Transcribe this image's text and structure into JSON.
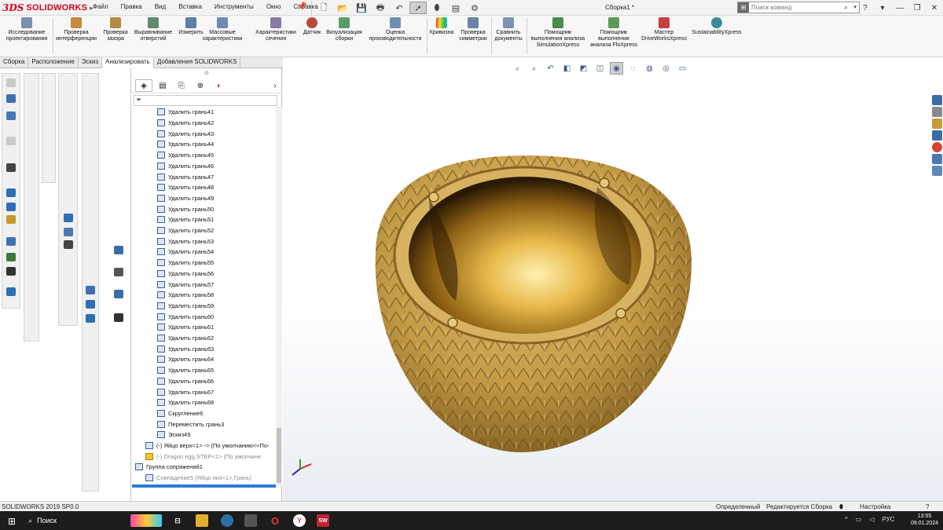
{
  "titlebar": {
    "logo_prefix": "3DS",
    "logo_text": "SOLIDWORKS",
    "menu": [
      "Файл",
      "Правка",
      "Вид",
      "Вставка",
      "Инструменты",
      "Окно",
      "Справка"
    ],
    "document_title": "Сборка1 *",
    "search_placeholder": "Поиск команд"
  },
  "commands": [
    {
      "label": "Исследование\nпроектирования"
    },
    {
      "label": "Проверка\nинтерференции"
    },
    {
      "label": "Проверка\nзазора"
    },
    {
      "label": "Выравнивание\nотверстий"
    },
    {
      "label": "Измерить"
    },
    {
      "label": "Массовые\nхарактеристики"
    },
    {
      "label": "Характеристики\nсечения"
    },
    {
      "label": "Датчик"
    },
    {
      "label": "Визуализация\nсборки"
    },
    {
      "label": "Оценка\nпроизводительности"
    },
    {
      "label": "Кривизна"
    },
    {
      "label": "Проверка\nсимметрии"
    },
    {
      "label": "Сравнить\nдокументы"
    },
    {
      "label": "Помощник\nвыполнения анализа\nSimulationXpress"
    },
    {
      "label": "Помощник\nвыполнения\nанализа FloXpress"
    },
    {
      "label": "Мастер\nDriveWorksXpress"
    },
    {
      "label": "SustainabilityXpress"
    }
  ],
  "tabs": [
    "Сборка",
    "Расположение",
    "Эскиз",
    "Анализировать",
    "Добавления SOLIDWORKS"
  ],
  "active_tab": "Анализировать",
  "tree": {
    "items": [
      "Удалить грань41",
      "Удалить грань42",
      "Удалить грань43",
      "Удалить грань44",
      "Удалить грань45",
      "Удалить грань46",
      "Удалить грань47",
      "Удалить грань48",
      "Удалить грань49",
      "Удалить грань50",
      "Удалить грань51",
      "Удалить грань52",
      "Удалить грань53",
      "Удалить грань54",
      "Удалить грань55",
      "Удалить грань56",
      "Удалить грань57",
      "Удалить грань58",
      "Удалить грань59",
      "Удалить грань60",
      "Удалить грань61",
      "Удалить грань62",
      "Удалить грань63",
      "Удалить грань64",
      "Удалить грань65",
      "Удалить грань66",
      "Удалить грань67",
      "Удалить грань68",
      "Скругление6",
      "Переместить грань3",
      "Эскиз49"
    ],
    "part_top": "(-) Яйцо верх<1> -> (По умолчанию<<По-",
    "step_file": "(-) Dragon egg.STEP<1> (По умолчани",
    "mates_group": "Группа сопряжений1",
    "mate_item": "Совпадение5 (Яйцо низ<1>,Грань)"
  },
  "status": {
    "version": "SOLIDWORKS 2019 SP0.0",
    "defined": "Определенный",
    "editing": "Редактируется Сборка",
    "settings": "Настройка"
  },
  "taskbar": {
    "search": "Поиск",
    "lang": "РУС",
    "time": "13:55",
    "date": "09.01.2024"
  },
  "colors": {
    "brand_red": "#d4001a",
    "selection_blue": "#2d7ad6",
    "model_gold": "#c9a24a"
  }
}
